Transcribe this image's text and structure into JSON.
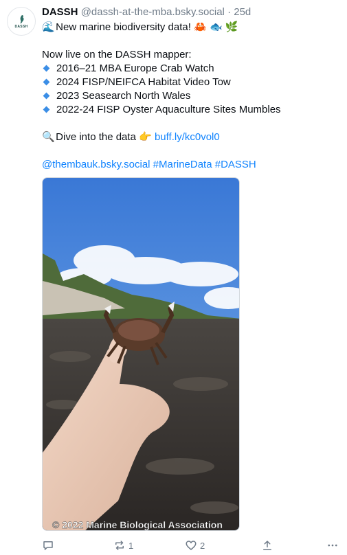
{
  "author": {
    "name": "DASSH",
    "handle": "@dassh-at-the-mba.bsky.social",
    "separator": "·",
    "time": "25d",
    "avatar_text": "DASSH"
  },
  "post": {
    "line1_emoji": "🌊",
    "line1_text": "New marine biodiversity data!",
    "line1_emojis": "🦀 🐟 🌿",
    "line2": "Now live on the DASSH mapper:",
    "bullets": [
      "2016–21 MBA Europe Crab Watch",
      "2024 FISP/NEIFCA Habitat Video Tow",
      "2023 Seasearch North Wales",
      "2022-24 FISP Oyster Aquaculture Sites Mumbles"
    ],
    "dive_emoji": "🔍",
    "dive_text": "Dive into the data",
    "dive_point": "👉",
    "dive_link": "buff.ly/kc0vol0",
    "tags": "@thembauk.bsky.social #MarineData #DASSH"
  },
  "media": {
    "watermark": "© 2022 Marine Biological Association",
    "description_icon": "photo-hand-holding-crab-icon"
  },
  "actions": {
    "reply_count": "",
    "repost_count": "1",
    "like_count": "2"
  },
  "colors": {
    "link": "#1083fe",
    "muted": "#6f7b88",
    "bullet": "#3b8ee6"
  }
}
